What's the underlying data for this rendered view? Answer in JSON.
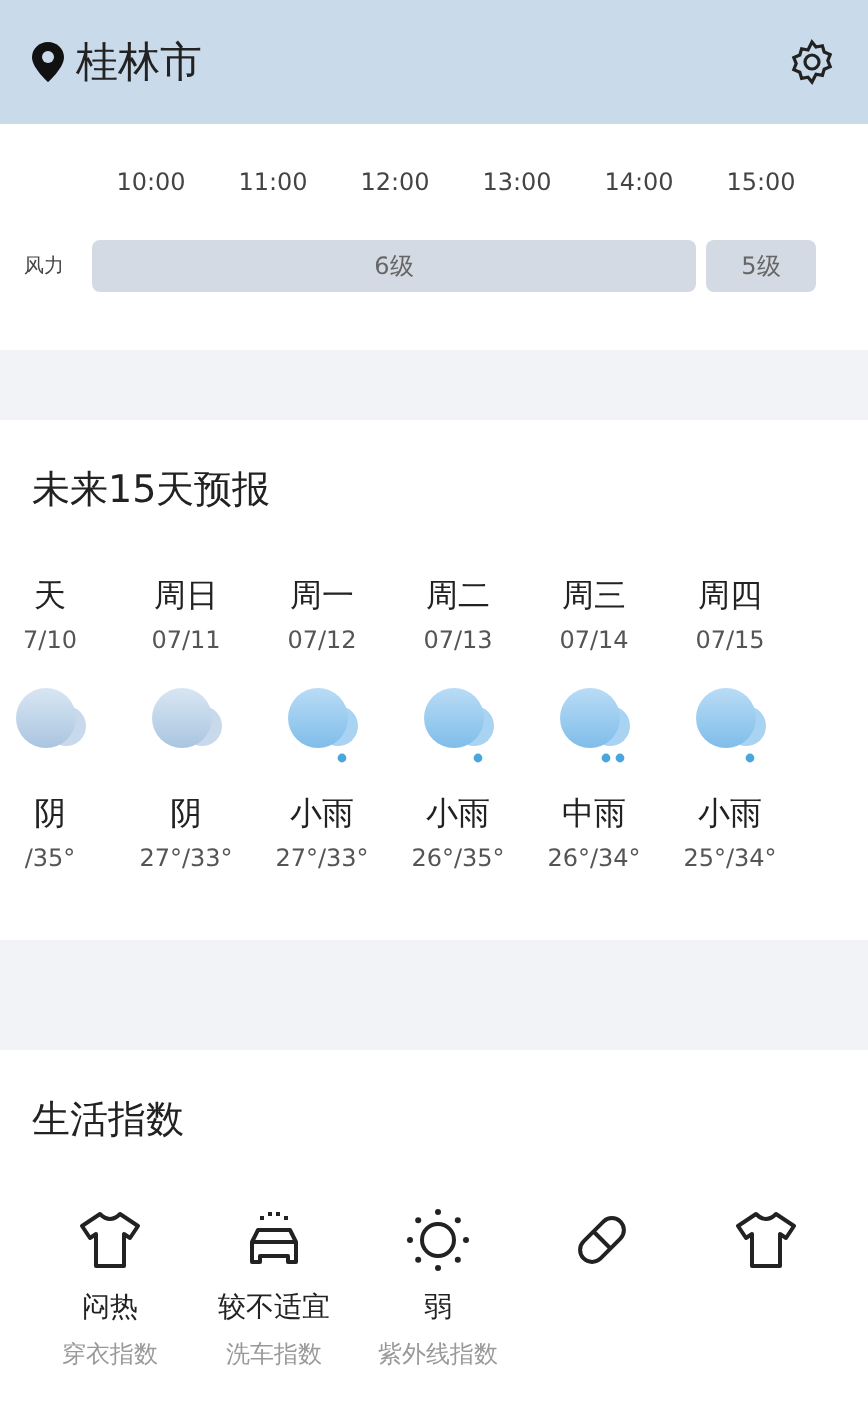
{
  "header": {
    "city": "桂林市"
  },
  "hourly": {
    "times": [
      "10:00",
      "11:00",
      "12:00",
      "13:00",
      "14:00",
      "15:00"
    ],
    "wind": {
      "label": "风力",
      "segments": [
        {
          "label": "6级"
        },
        {
          "label": "5级"
        }
      ]
    }
  },
  "forecast": {
    "title": "未来15天预报",
    "days": [
      {
        "day": "天",
        "date": "7/10",
        "kind": "cloud",
        "condition": "阴",
        "temp": "/35°"
      },
      {
        "day": "周日",
        "date": "07/11",
        "kind": "cloud",
        "condition": "阴",
        "temp": "27°/33°"
      },
      {
        "day": "周一",
        "date": "07/12",
        "kind": "light-rain",
        "condition": "小雨",
        "temp": "27°/33°"
      },
      {
        "day": "周二",
        "date": "07/13",
        "kind": "light-rain",
        "condition": "小雨",
        "temp": "26°/35°"
      },
      {
        "day": "周三",
        "date": "07/14",
        "kind": "moderate-rain",
        "condition": "中雨",
        "temp": "26°/34°"
      },
      {
        "day": "周四",
        "date": "07/15",
        "kind": "light-rain",
        "condition": "小雨",
        "temp": "25°/34°"
      }
    ]
  },
  "life": {
    "title": "生活指数",
    "items": [
      {
        "kind": "shirt",
        "value": "闷热",
        "name": "穿衣指数"
      },
      {
        "kind": "car",
        "value": "较不适宜",
        "name": "洗车指数"
      },
      {
        "kind": "sun",
        "value": "弱",
        "name": "紫外线指数"
      },
      {
        "kind": "pill"
      },
      {
        "kind": "shirt"
      }
    ]
  }
}
